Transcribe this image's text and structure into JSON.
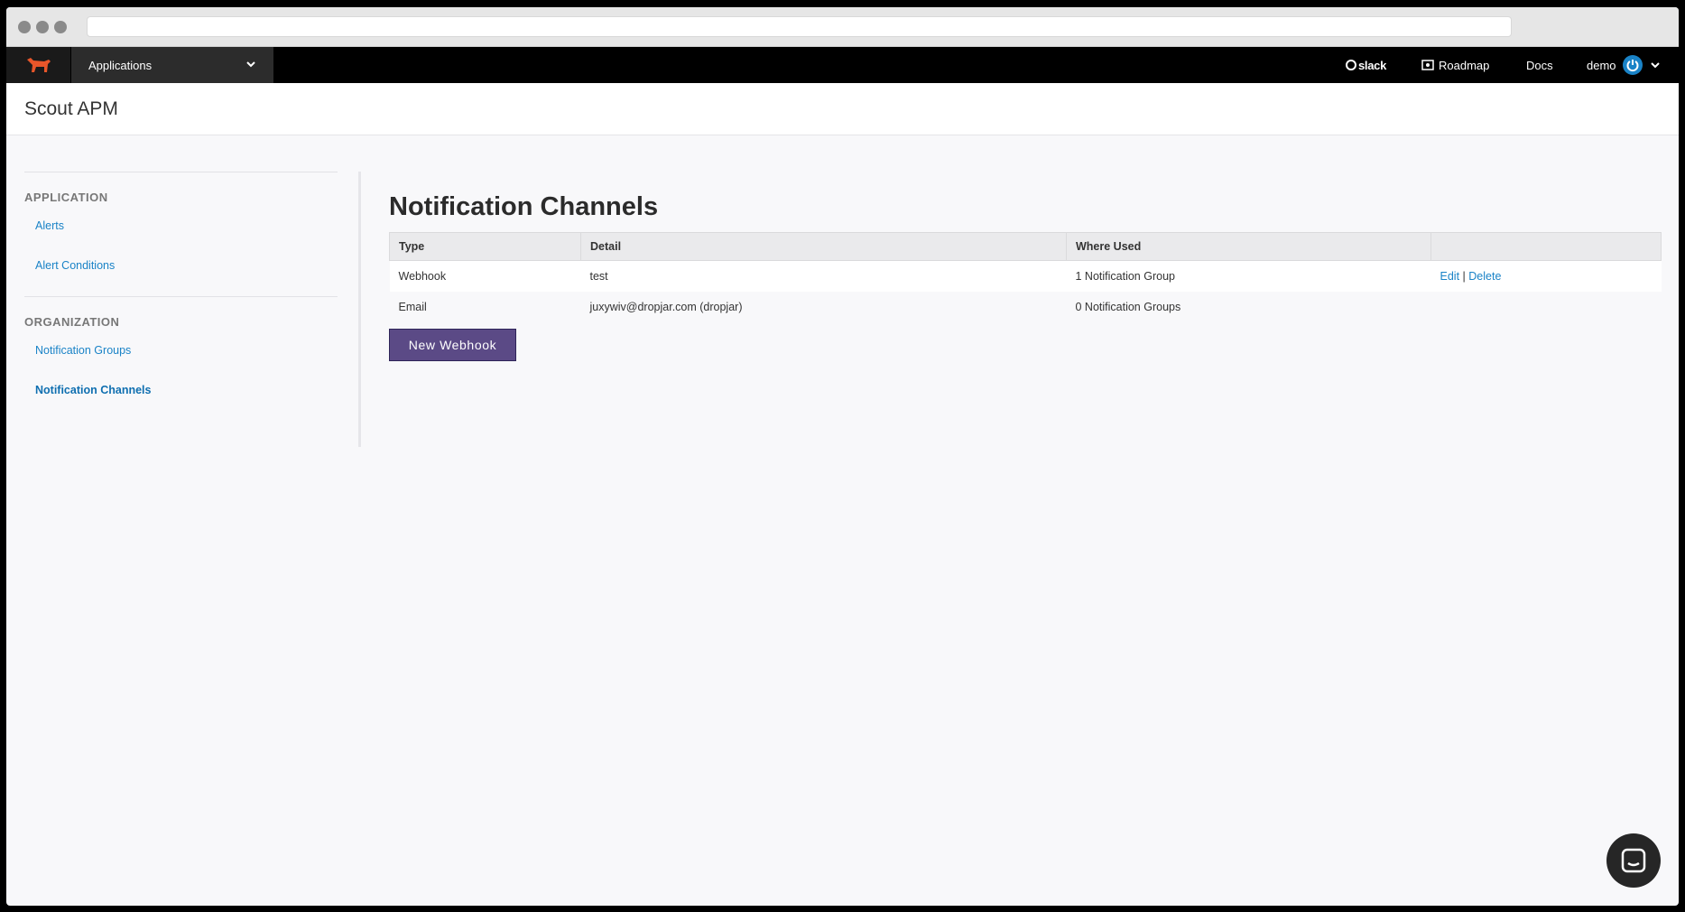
{
  "nav": {
    "app_select_label": "Applications",
    "slack_label": "slack",
    "roadmap_label": "Roadmap",
    "docs_label": "Docs",
    "user_label": "demo"
  },
  "header": {
    "title": "Scout APM"
  },
  "sidebar": {
    "sections": [
      {
        "label": "APPLICATION",
        "items": [
          "Alerts",
          "Alert Conditions"
        ]
      },
      {
        "label": "ORGANIZATION",
        "items": [
          "Notification Groups",
          "Notification Channels"
        ]
      }
    ],
    "active_item": "Notification Channels"
  },
  "main": {
    "title": "Notification Channels",
    "table": {
      "columns": [
        "Type",
        "Detail",
        "Where Used",
        ""
      ],
      "rows": [
        {
          "type": "Webhook",
          "detail": "test",
          "where_used": "1 Notification Group",
          "edit": "Edit",
          "separator": "|",
          "delete": "Delete"
        },
        {
          "type": "Email",
          "detail": "juxywiv@dropjar.com (dropjar)",
          "where_used": "0 Notification Groups"
        }
      ]
    },
    "new_button": "New Webhook"
  },
  "colors": {
    "accent": "#1a83c7",
    "button": "#5b4a86",
    "logo": "#e8562a"
  }
}
